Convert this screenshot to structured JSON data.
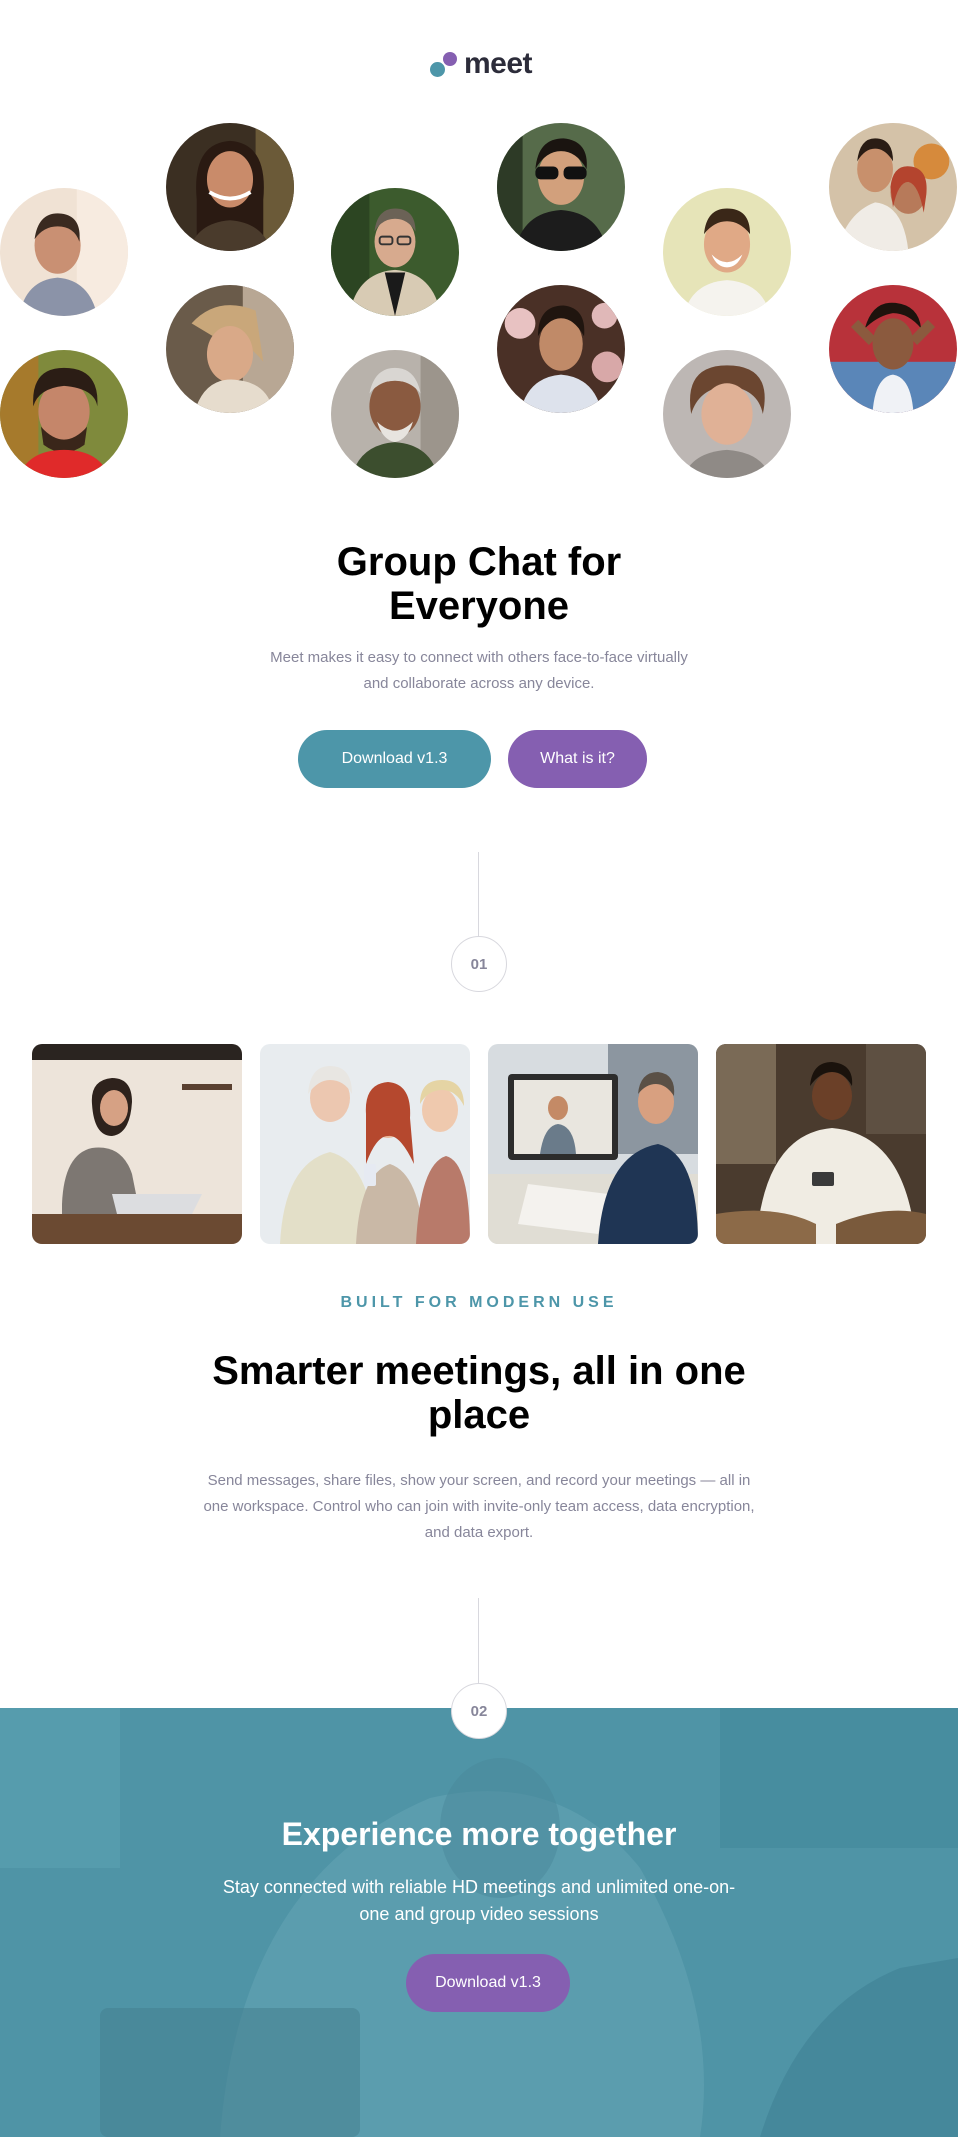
{
  "header": {
    "logo_text": "meet"
  },
  "hero": {
    "title_line1": "Group Chat for",
    "title_line2": "Everyone",
    "description": "Meet makes it easy to connect with others face-to-face virtually and collaborate across any device.",
    "primary_button": "Download v1.3",
    "secondary_button": "What is it?"
  },
  "steps": {
    "first": "01",
    "second": "02"
  },
  "features": {
    "eyebrow": "BUILT FOR MODERN USE",
    "title": "Smarter meetings, all in one place",
    "description": "Send messages, share files, show your screen, and record your meetings — all in one workspace. Control who can join with invite-only team access, data encryption, and data export."
  },
  "cta": {
    "title": "Experience more together",
    "description": "Stay connected with reliable HD meetings and unlimited one-on-one and group video sessions",
    "button": "Download v1.3"
  },
  "colors": {
    "teal": "#4d96a9",
    "purple": "#855fb1",
    "heading": "#000000",
    "body_text": "#87869a",
    "cta_background": "#4f94a6"
  }
}
